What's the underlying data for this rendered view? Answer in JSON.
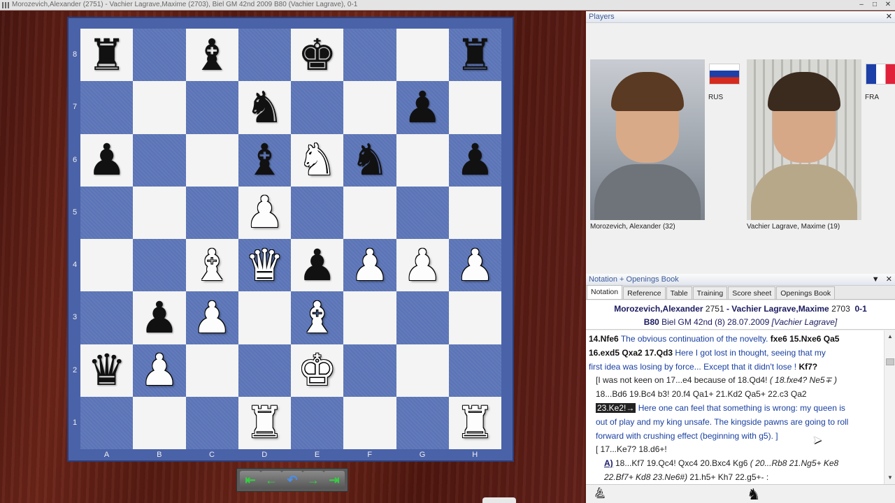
{
  "window": {
    "title": "Morozevich,Alexander (2751) - Vachier Lagrave,Maxime (2703), Biel GM 42nd 2009  B80  (Vachier Lagrave), 0-1",
    "minimize_glyph": "–",
    "maximize_glyph": "□",
    "close_glyph": "✕"
  },
  "board": {
    "ranks": [
      "8",
      "7",
      "6",
      "5",
      "4",
      "3",
      "2",
      "1"
    ],
    "files": [
      "A",
      "B",
      "C",
      "D",
      "E",
      "F",
      "G",
      "H"
    ],
    "position": [
      [
        "bR",
        "",
        "bB",
        "",
        "bK",
        "",
        "",
        "bR"
      ],
      [
        "",
        "",
        "",
        "bN",
        "",
        "",
        "bP",
        ""
      ],
      [
        "bP",
        "",
        "",
        "bB",
        "wN",
        "bN",
        "",
        "bP"
      ],
      [
        "",
        "",
        "",
        "wP",
        "",
        "",
        "",
        ""
      ],
      [
        "",
        "",
        "wB",
        "wQ",
        "bP",
        "wP",
        "wP",
        "wP"
      ],
      [
        "",
        "bP",
        "wP",
        "",
        "wB",
        "",
        "",
        ""
      ],
      [
        "bQ",
        "wP",
        "",
        "",
        "wK",
        "",
        "",
        ""
      ],
      [
        "",
        "",
        "",
        "wR",
        "",
        "",
        "",
        "wR"
      ]
    ],
    "piece_glyphs": {
      "wK": "♚",
      "wQ": "♛",
      "wR": "♜",
      "wB": "♝",
      "wN": "♞",
      "wP": "♟",
      "bK": "♚",
      "bQ": "♛",
      "bR": "♜",
      "bB": "♝",
      "bN": "♞",
      "bP": "♟"
    }
  },
  "nav": {
    "first": "⇤",
    "back": "←",
    "takeback": "↶",
    "forward": "→",
    "last": "⇥"
  },
  "players_panel": {
    "title": "Players",
    "close_glyph": "✕",
    "white": {
      "name": "Morozevich, Alexander  (32)",
      "country": "RUS"
    },
    "black": {
      "name": "Vachier Lagrave, Maxime  (19)",
      "country": "FRA"
    }
  },
  "notation_panel": {
    "title": "Notation + Openings Book",
    "menu_glyph": "▼",
    "close_glyph": "✕",
    "tabs": [
      "Notation",
      "Reference",
      "Table",
      "Training",
      "Score sheet",
      "Openings Book"
    ],
    "header": {
      "white": "Morozevich,Alexander",
      "white_elo": "2751",
      "sep": " - ",
      "black": "Vachier Lagrave,Maxime",
      "black_elo": "2703",
      "result": "0-1",
      "eco": "B80",
      "event": "Biel GM 42nd (8) 28.07.2009",
      "annotator": "[Vachier Lagrave]"
    },
    "lines": {
      "l1_mv1": "14.Nfe6",
      "l1_cm": " The obvious continuation of the novelty. ",
      "l1_mv2": "fxe6  15.Nxe6  Qa5",
      "l2_mv1": "16.exd5  Qxa2  17.Qd3",
      "l2_cm": " Here I got lost in thought, seeing that my",
      "l3_cm": "first idea was losing by force... Except that it didn't lose ! ",
      "l3_mv": "Kf7?",
      "l4_var": "[I was not keen on  17...e4 because of  18.Qd4! ",
      "l4_it": "( 18.fxe4?  Ne5∓ )",
      "l5_var": "18...Bd6  19.Bc4  b3!  20.f4  Qa1+  21.Kd2  Qa5+  22.c3  Qa2",
      "l6_sel": "23.Ke2!→",
      "l6_cm": " Here one can feel that something is wrong: my queen is",
      "l7_cm": "out of play and my king unsafe. The kingside pawns are going to roll",
      "l8_cm": "forward with crushing effect (beginning with g5). ]",
      "l9_var": "[ 17...Ke7?  18.d6+!",
      "l10_a": "A)",
      "l10_var": " 18...Kf7  19.Qc4!  Qxc4  20.Bxc4  Kg6 ",
      "l10_it": "( 20...Rb8  21.Ng5+  Ke8",
      "l11_it": "22.Bf7+  Kd8  23.Ne6#)",
      "l11_var": " 21.h5+  Kh7  22.g5+- :"
    },
    "bottom": {
      "white_king": "♙",
      "black_knight": "♞"
    }
  },
  "colors": {
    "dark_square": "#5b74b6",
    "light_square": "#f4f4f4",
    "accent_text": "#1a40a0"
  }
}
